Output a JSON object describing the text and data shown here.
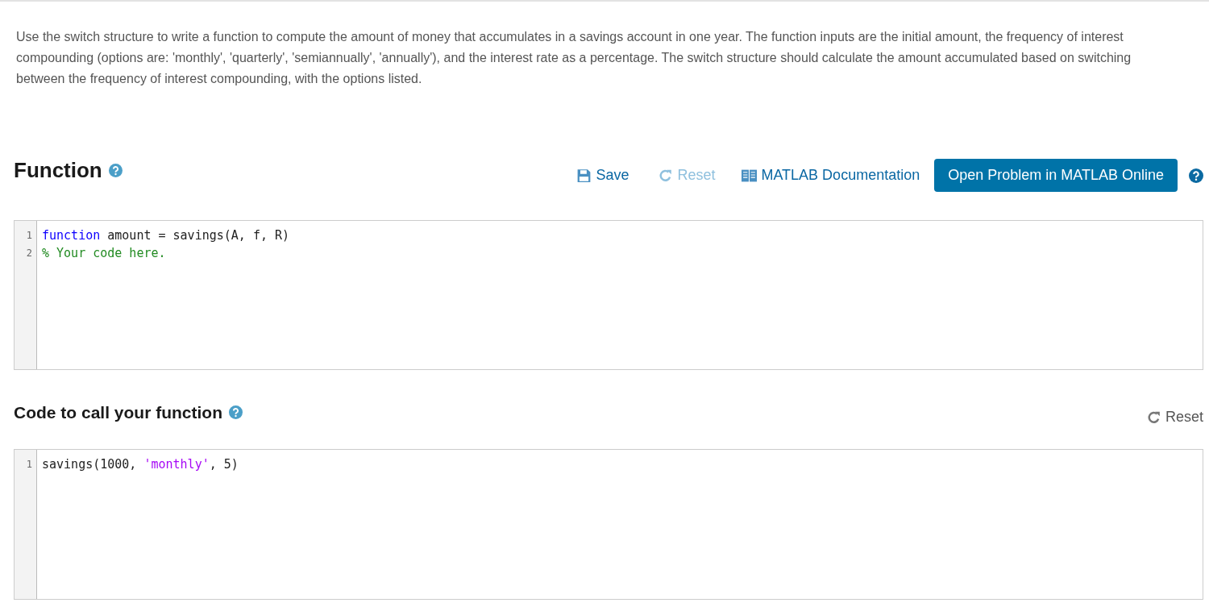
{
  "description": "Use the switch structure to write a function to compute the amount of money that accumulates in a savings account in one year. The function inputs are the initial amount, the frequency of interest compounding (options are: 'monthly', 'quarterly', 'semiannually', 'annually'), and the interest rate as a percentage. The switch structure should calculate the amount accumulated based on switching between the frequency of interest compounding, with the options listed.",
  "function_section": {
    "title": "Function",
    "toolbar": [
      {
        "kind": "save",
        "label": "Save",
        "disabled": false
      },
      {
        "kind": "reset",
        "label": "Reset",
        "disabled": true
      },
      {
        "kind": "doc",
        "label": "MATLAB Documentation",
        "disabled": false
      },
      {
        "kind": "primary",
        "label": "Open Problem in MATLAB Online",
        "disabled": false
      },
      {
        "kind": "help",
        "disabled": false
      }
    ],
    "code": [
      {
        "number": "1",
        "tokens": [
          {
            "kind": "keyword",
            "text": "function"
          },
          {
            "kind": "plain",
            "text": " amount = savings(A, f, R)"
          }
        ]
      },
      {
        "number": "2",
        "tokens": [
          {
            "kind": "comment",
            "text": "% Your code here."
          }
        ]
      }
    ]
  },
  "call_section": {
    "title": "Code to call your function",
    "toolbar": [
      {
        "kind": "reset",
        "label": "Reset",
        "disabled": false
      }
    ],
    "code": [
      {
        "number": "1",
        "tokens": [
          {
            "kind": "plain",
            "text": "savings(1000, "
          },
          {
            "kind": "string",
            "text": "'monthly'"
          },
          {
            "kind": "plain",
            "text": ", 5)"
          }
        ]
      }
    ]
  }
}
